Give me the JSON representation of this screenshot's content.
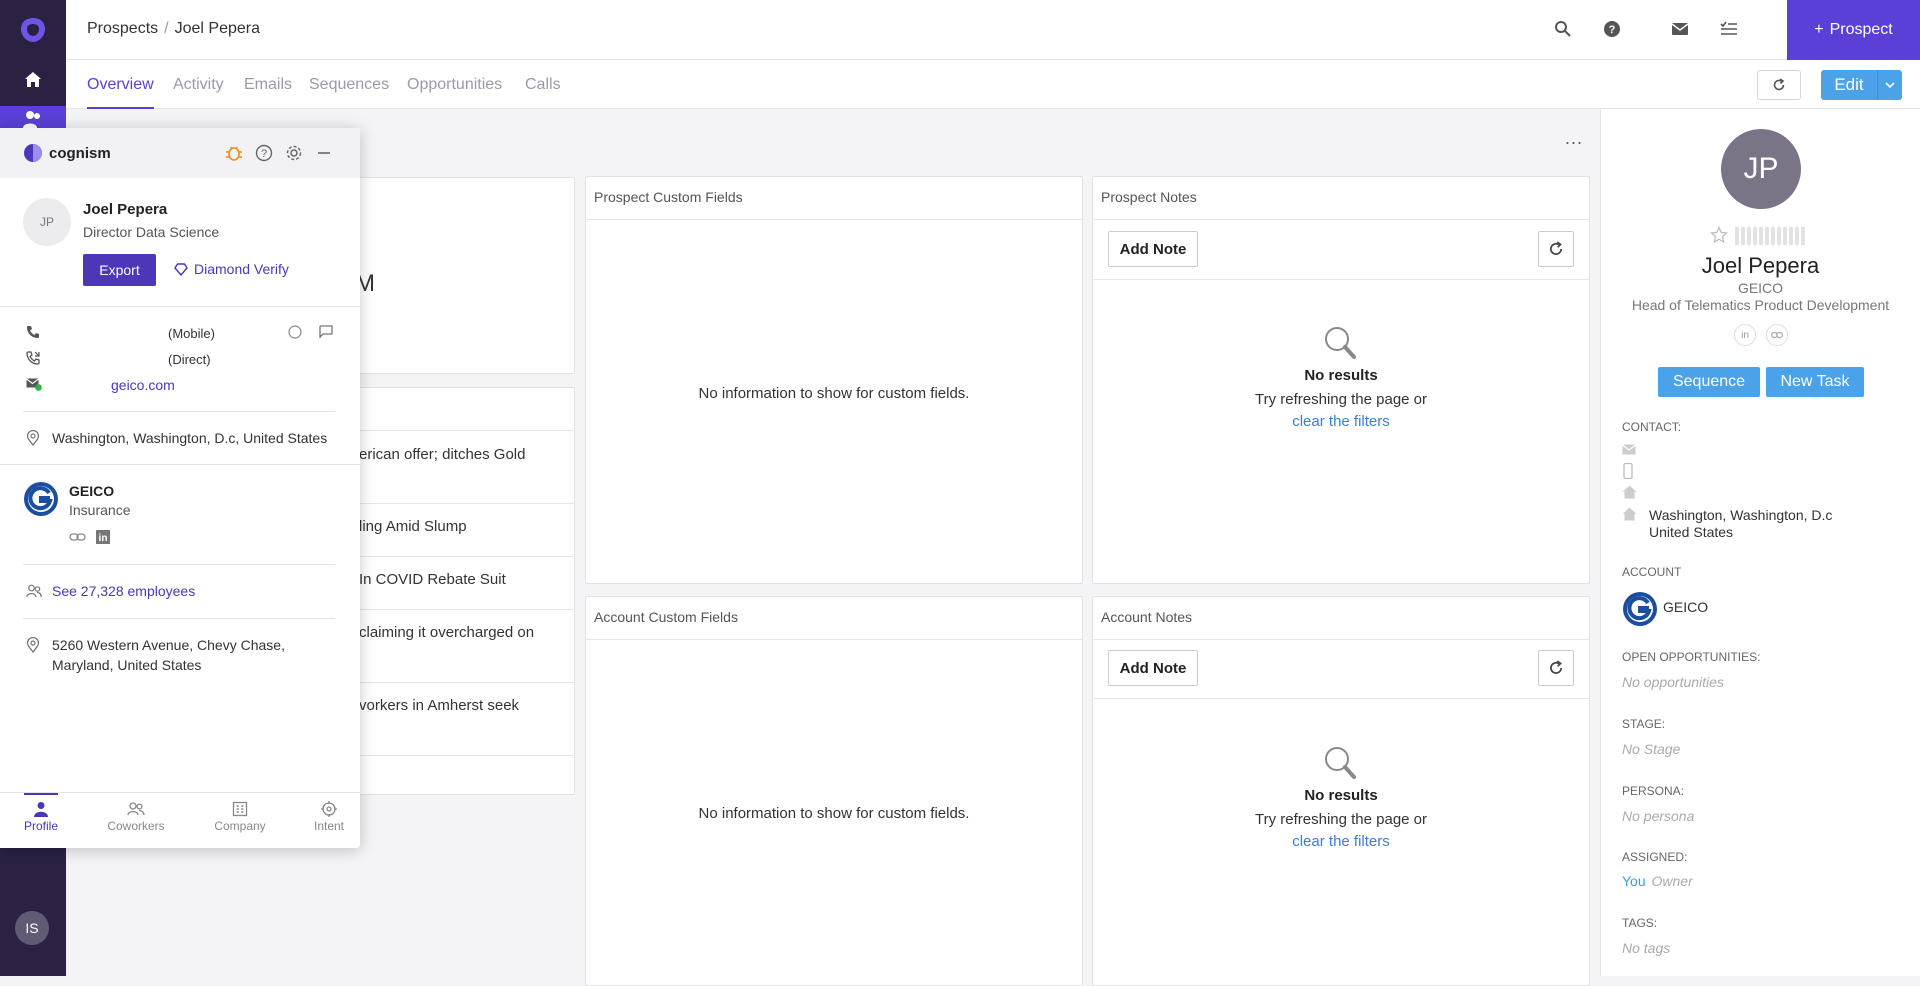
{
  "breadcrumb": {
    "section": "Prospects",
    "name": "Joel Pepera"
  },
  "topbar": {
    "add_prospect_label": "Prospect"
  },
  "tabs": [
    "Overview",
    "Activity",
    "Emails",
    "Sequences",
    "Opportunities",
    "Calls"
  ],
  "actions": {
    "edit_label": "Edit",
    "more": "..."
  },
  "left_panels": {
    "metric_fragment": "M",
    "news": [
      "erican offer; ditches Gold",
      "ling Amid Slump",
      "In COVID Rebate Suit",
      "claiming it overcharged on",
      "vorkers in Amherst seek"
    ]
  },
  "panels": {
    "prospect_custom": {
      "title": "Prospect Custom Fields",
      "empty": "No information to show for custom fields."
    },
    "prospect_notes": {
      "title": "Prospect Notes",
      "add_note": "Add Note",
      "no_results": "No results",
      "hint": "Try refreshing the page or",
      "link": "clear the filters"
    },
    "account_custom": {
      "title": "Account Custom Fields",
      "empty": "No information to show for custom fields."
    },
    "account_notes": {
      "title": "Account Notes",
      "add_note": "Add Note",
      "no_results": "No results",
      "hint": "Try refreshing the page or",
      "link": "clear the filters"
    }
  },
  "profile": {
    "initials": "JP",
    "name": "Joel Pepera",
    "company": "GEICO",
    "title": "Head of Telematics Product Development",
    "sequence_label": "Sequence",
    "new_task_label": "New Task",
    "contact_label": "CONTACT:",
    "address_line1": "Washington, Washington, D.c",
    "address_line2": "United States",
    "account_label": "ACCOUNT",
    "account_name": "GEICO",
    "open_opps_label": "OPEN OPPORTUNITIES:",
    "open_opps_value": "No opportunities",
    "stage_label": "STAGE:",
    "stage_value": "No Stage",
    "persona_label": "PERSONA:",
    "persona_value": "No persona",
    "assigned_label": "ASSIGNED:",
    "assigned_you": "You",
    "assigned_owner": "Owner",
    "tags_label": "TAGS:",
    "tags_value": "No tags"
  },
  "cognism": {
    "brand": "cognism",
    "initials": "JP",
    "name": "Joel Pepera",
    "title": "Director Data Science",
    "export_label": "Export",
    "verify_label": "Diamond Verify",
    "mobile_label": "(Mobile)",
    "direct_label": "(Direct)",
    "domain": "geico.com",
    "location": "Washington, Washington, D.c, United States",
    "company_name": "GEICO",
    "industry": "Insurance",
    "employees_link": "See 27,328 employees",
    "hq_line1": "5260 Western Avenue, Chevy Chase,",
    "hq_line2": "Maryland, United States",
    "tabs": [
      "Profile",
      "Coworkers",
      "Company",
      "Intent"
    ]
  },
  "user": {
    "initials": "IS"
  },
  "colors": {
    "brand": "#5b3fd6",
    "nav_bg": "#2c2142",
    "primary_button": "#4aa3e8",
    "link": "#3a7fd5",
    "cognism_accent": "#4d36b8"
  }
}
